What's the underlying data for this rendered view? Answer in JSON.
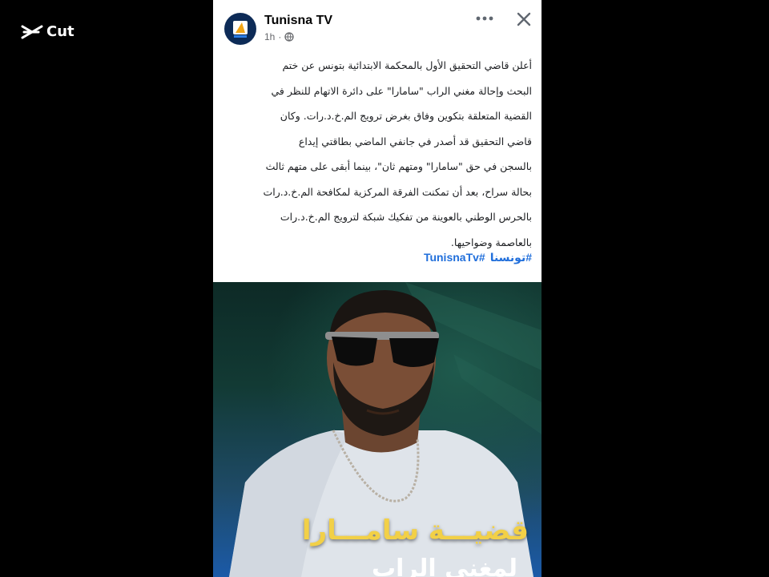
{
  "watermark": {
    "label": "Cut",
    "icon": "capcut-logo-icon"
  },
  "post": {
    "page_name": "Tunisna TV",
    "time": "1h",
    "separator": "·",
    "privacy_icon": "globe-icon",
    "more_icon": "more-horizontal-icon",
    "close_icon": "close-icon",
    "body_lines": [
      "أعلن قاضي التحقيق الأول بالمحكمة الابتدائية بتونس عن ختم",
      "البحث وإحالة مغني الراب \"سامارا\" على دائرة الاتهام للنظر في",
      "القضية المتعلقة بتكوين وفاق بغرض ترويج الم.خ.د.رات. وكان",
      "قاضي التحقيق قد أصدر في جانفي الماضي بطاقتي إيداع",
      "بالسجن في حق \"سامارا\" ومتهم ثان\"، بينما أبقى على متهم ثالث",
      "بحالة سراح، بعد أن تمكنت الفرقة المركزية لمكافحة الم.خ.د.رات",
      "بالحرس الوطني بالعوينة من تفكيك شبكة لترويج الم.خ.د.رات",
      "بالعاصمة وضواحيها."
    ],
    "hashtags": [
      "#تونسنا",
      "#TunisnaTv"
    ],
    "image": {
      "overlay_title": "قضيـــة سامـــارا",
      "overlay_subtitle": "لمغني الراب",
      "accent_color": "#f2d047",
      "background_top": "#0d2a26",
      "background_bottom": "#1b5aa8"
    }
  },
  "colors": {
    "background": "#000000",
    "card": "#ffffff",
    "link": "#216fdb",
    "secondary_text": "#65676b"
  }
}
